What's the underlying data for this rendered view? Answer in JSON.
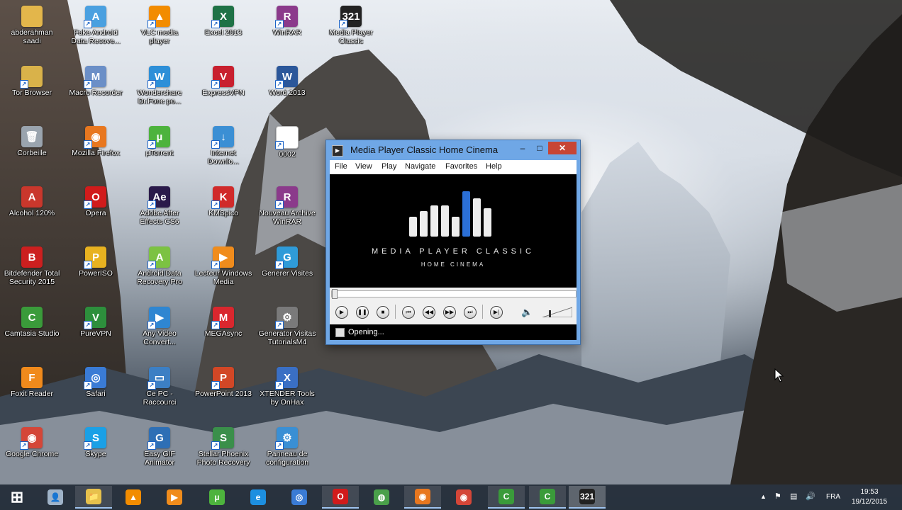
{
  "desktop": {
    "icons": [
      {
        "label": "abderahman saadi",
        "color": "#e3b64b",
        "glyph": ""
      },
      {
        "label": "Tor Browser",
        "color": "#d9b24a",
        "glyph": ""
      },
      {
        "label": "Corbeille",
        "color": "#9aa4ae",
        "glyph": "🗑"
      },
      {
        "label": "Alcohol 120%",
        "color": "#c9372c",
        "glyph": "A"
      },
      {
        "label": "Bitdefender Total Security 2015",
        "color": "#cc1f1f",
        "glyph": "B"
      },
      {
        "label": "Camtasia Studio",
        "color": "#3a9b3a",
        "glyph": "C"
      },
      {
        "label": "Foxit Reader",
        "color": "#f08a1c",
        "glyph": "F"
      },
      {
        "label": "Google Chrome",
        "color": "#d44638",
        "glyph": "◉"
      },
      {
        "label": "Fake Android Data Recove...",
        "color": "#4aa0e0",
        "glyph": "A"
      },
      {
        "label": "Macro Recorder",
        "color": "#6b8fc7",
        "glyph": "M"
      },
      {
        "label": "Mozilla Firefox",
        "color": "#e8771f",
        "glyph": "◉"
      },
      {
        "label": "Opera",
        "color": "#d11b1b",
        "glyph": "O"
      },
      {
        "label": "PowerISO",
        "color": "#e8b220",
        "glyph": "P"
      },
      {
        "label": "PureVPN",
        "color": "#2d8f3c",
        "glyph": "V"
      },
      {
        "label": "Safari",
        "color": "#3a7bd5",
        "glyph": "◎"
      },
      {
        "label": "Skype",
        "color": "#1aa0e6",
        "glyph": "S"
      },
      {
        "label": "VLC media player",
        "color": "#f28c00",
        "glyph": "▲"
      },
      {
        "label": "Wondershare Dr.Fone po...",
        "color": "#2d8fd8",
        "glyph": "W"
      },
      {
        "label": "µTorrent",
        "color": "#4db33d",
        "glyph": "µ"
      },
      {
        "label": "Adobe After Effects CS6",
        "color": "#2a1a4a",
        "glyph": "Ae"
      },
      {
        "label": "Android Data Recovery Pro",
        "color": "#7cc242",
        "glyph": "A"
      },
      {
        "label": "Any Video Convert...",
        "color": "#2f86d1",
        "glyph": "▶"
      },
      {
        "label": "Ce PC - Raccourci",
        "color": "#3c7fc4",
        "glyph": "▭"
      },
      {
        "label": "Easy GIF Animator",
        "color": "#2e6fb5",
        "glyph": "G"
      },
      {
        "label": "Excel 2013",
        "color": "#1f7246",
        "glyph": "X"
      },
      {
        "label": "ExpressVPN",
        "color": "#c8202f",
        "glyph": "V"
      },
      {
        "label": "Internet Downlo...",
        "color": "#3b8fd4",
        "glyph": "↓"
      },
      {
        "label": "KMSpico",
        "color": "#d02a2a",
        "glyph": "K"
      },
      {
        "label": "Lecteur Windows Media",
        "color": "#f08c1c",
        "glyph": "▶"
      },
      {
        "label": "MEGAsync",
        "color": "#d9272e",
        "glyph": "M"
      },
      {
        "label": "PowerPoint 2013",
        "color": "#d24726",
        "glyph": "P"
      },
      {
        "label": "Stellar Phoenix Photo Recovery",
        "color": "#3a8f4a",
        "glyph": "S"
      },
      {
        "label": "WinRAR",
        "color": "#8b3a8b",
        "glyph": "R"
      },
      {
        "label": "Word 2013",
        "color": "#2b579a",
        "glyph": "W"
      },
      {
        "label": "0002",
        "color": "#ffffff",
        "glyph": ""
      },
      {
        "label": "Nouveau Archive WinRAR",
        "color": "#8b3a8b",
        "glyph": "R"
      },
      {
        "label": "Generer Visites",
        "color": "#2f9bd8",
        "glyph": "G"
      },
      {
        "label": "Generator Visitas TutorialsM4",
        "color": "#7a7a7a",
        "glyph": "⚙"
      },
      {
        "label": "XTENDER Tools by OnHax",
        "color": "#3a6fc4",
        "glyph": "X"
      },
      {
        "label": "Panneau de configuration",
        "color": "#3a8fd4",
        "glyph": "⚙"
      },
      {
        "label": "Media Player Classic",
        "color": "#222222",
        "glyph": "321"
      }
    ]
  },
  "mpc": {
    "title": "Media Player Classic Home Cinema",
    "min": "‒",
    "max": "□",
    "close": "✕",
    "menu": [
      "File",
      "View",
      "Play",
      "Navigate",
      "Favorites",
      "Help"
    ],
    "logo_line1": "MEDIA PLAYER CLASSIC",
    "logo_line2": "HOME CINEMA",
    "status": "Opening...",
    "seek_position": 0
  },
  "taskbar": {
    "items": [
      {
        "name": "start-button",
        "icon": "windows-logo-icon",
        "color": "#ffffff",
        "glyph": "⊞"
      },
      {
        "name": "taskbar-item-homegroup",
        "icon": "user-icon",
        "color": "#9fb3c8",
        "glyph": "👤"
      },
      {
        "name": "taskbar-item-explorer",
        "icon": "folder-icon",
        "color": "#e7c14c",
        "glyph": "📁"
      },
      {
        "name": "taskbar-item-vlc",
        "icon": "vlc-icon",
        "color": "#f28c00",
        "glyph": "▲"
      },
      {
        "name": "taskbar-item-media",
        "icon": "media-icon",
        "color": "#f08c1c",
        "glyph": "▶"
      },
      {
        "name": "taskbar-item-utorrent",
        "icon": "utorrent-icon",
        "color": "#4db33d",
        "glyph": "µ"
      },
      {
        "name": "taskbar-item-ie",
        "icon": "ie-icon",
        "color": "#1d8fe0",
        "glyph": "e"
      },
      {
        "name": "taskbar-item-safari",
        "icon": "safari-icon",
        "color": "#3a7bd5",
        "glyph": "◎"
      },
      {
        "name": "taskbar-item-opera",
        "icon": "opera-icon",
        "color": "#d11b1b",
        "glyph": "O"
      },
      {
        "name": "taskbar-item-globe",
        "icon": "globe-icon",
        "color": "#4aa04a",
        "glyph": "◍"
      },
      {
        "name": "taskbar-item-firefox",
        "icon": "firefox-icon",
        "color": "#e8771f",
        "glyph": "◉"
      },
      {
        "name": "taskbar-item-chrome",
        "icon": "chrome-icon",
        "color": "#d44638",
        "glyph": "◉"
      },
      {
        "name": "taskbar-item-camtasia-1",
        "icon": "camtasia-icon",
        "color": "#3a9b3a",
        "glyph": "C"
      },
      {
        "name": "taskbar-item-camtasia-2",
        "icon": "camtasia-icon",
        "color": "#3a9b3a",
        "glyph": "C"
      },
      {
        "name": "taskbar-item-mpc",
        "icon": "mpc-icon",
        "color": "#222222",
        "glyph": "321"
      }
    ],
    "tray": {
      "lang": "FRA",
      "time": "19:53",
      "date": "19/12/2015"
    }
  }
}
